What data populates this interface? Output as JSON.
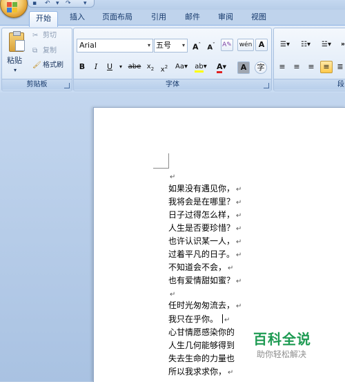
{
  "tabs": [
    "开始",
    "插入",
    "页面布局",
    "引用",
    "邮件",
    "审阅",
    "视图"
  ],
  "clipboard": {
    "paste_label": "粘贴",
    "cut_label": "剪切",
    "copy_label": "复制",
    "format_painter_label": "格式刷",
    "group_label": "剪贴板"
  },
  "font": {
    "font_name": "Arial",
    "font_size": "五号",
    "group_label": "字体"
  },
  "paragraph": {
    "group_label": "段"
  },
  "document": {
    "lines": [
      "",
      "如果没有遇见你，",
      "我将会是在哪里？",
      "日子过得怎么样，",
      "人生是否要珍惜？",
      "也许认识某一人，",
      "过着平凡的日子。",
      "不知道会不会，",
      "也有爱情甜如蜜？",
      "",
      "任时光匆匆流去，",
      "我只在乎你。",
      "心甘情愿感染你的",
      "人生几何能够得到",
      "失去生命的力量也",
      "所以我求求你，"
    ]
  },
  "watermark": {
    "title": "百科全说",
    "subtitle": "助你轻松解决"
  }
}
